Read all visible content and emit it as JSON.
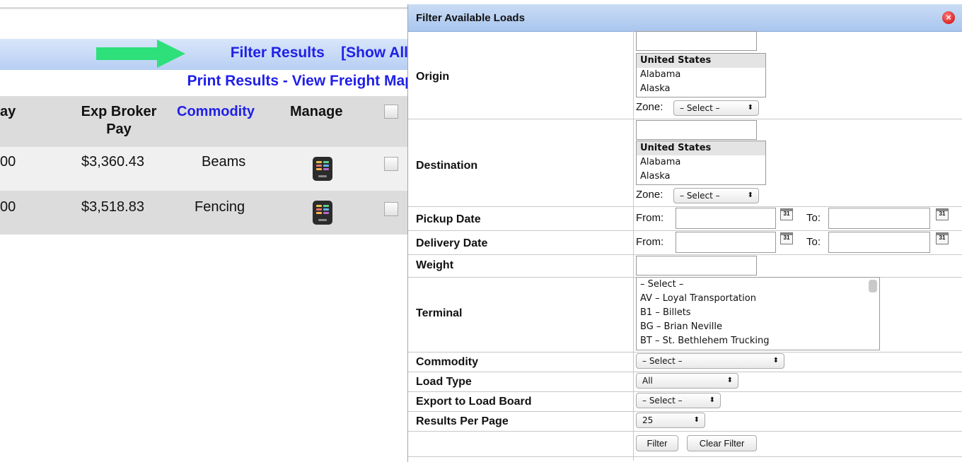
{
  "background": {
    "filter_results": "Filter Results",
    "show_all": "[Show All]",
    "print_results": "Print Results",
    "separator": " - ",
    "view_freight_map": "View Freight Map",
    "headers": {
      "pay_fragment": "ay",
      "exp_broker_pay_line1": "Exp Broker",
      "exp_broker_pay_line2": "Pay",
      "commodity": "Commodity",
      "manage": "Manage"
    },
    "rows": [
      {
        "pay": "00",
        "exp_broker_pay": "$3,360.43",
        "commodity": "Beams"
      },
      {
        "pay": "00",
        "exp_broker_pay": "$3,518.83",
        "commodity": "Fencing"
      }
    ],
    "arrow_color": "#2ee07a"
  },
  "dialog": {
    "title": "Filter Available Loads",
    "close_glyph": "×",
    "labels": {
      "origin": "Origin",
      "destination": "Destination",
      "pickup_date": "Pickup Date",
      "delivery_date": "Delivery Date",
      "weight": "Weight",
      "terminal": "Terminal",
      "commodity": "Commodity",
      "load_type": "Load Type",
      "export_to_load_board": "Export to Load Board",
      "results_per_page": "Results Per Page"
    },
    "origin": {
      "text_value": "",
      "states": [
        "United States",
        "Alabama",
        "Alaska"
      ],
      "zone_label": "Zone:",
      "zone_value": "– Select –"
    },
    "destination": {
      "text_value": "",
      "states": [
        "United States",
        "Alabama",
        "Alaska"
      ],
      "zone_label": "Zone:",
      "zone_value": "– Select –"
    },
    "date_from_label": "From:",
    "date_to_label": "To:",
    "calendar_glyph": "31",
    "terminal_options": [
      "– Select –",
      "AV – Loyal Transportation",
      "B1 – Billets",
      "BG – Brian Neville",
      "BT – St. Bethlehem Trucking"
    ],
    "commodity_value": "– Select –",
    "load_type_value": "All",
    "export_value": "– Select –",
    "results_per_page_value": "25",
    "filter_button": "Filter",
    "clear_filter_button": "Clear Filter",
    "dropdown_arrow": "⬍"
  }
}
